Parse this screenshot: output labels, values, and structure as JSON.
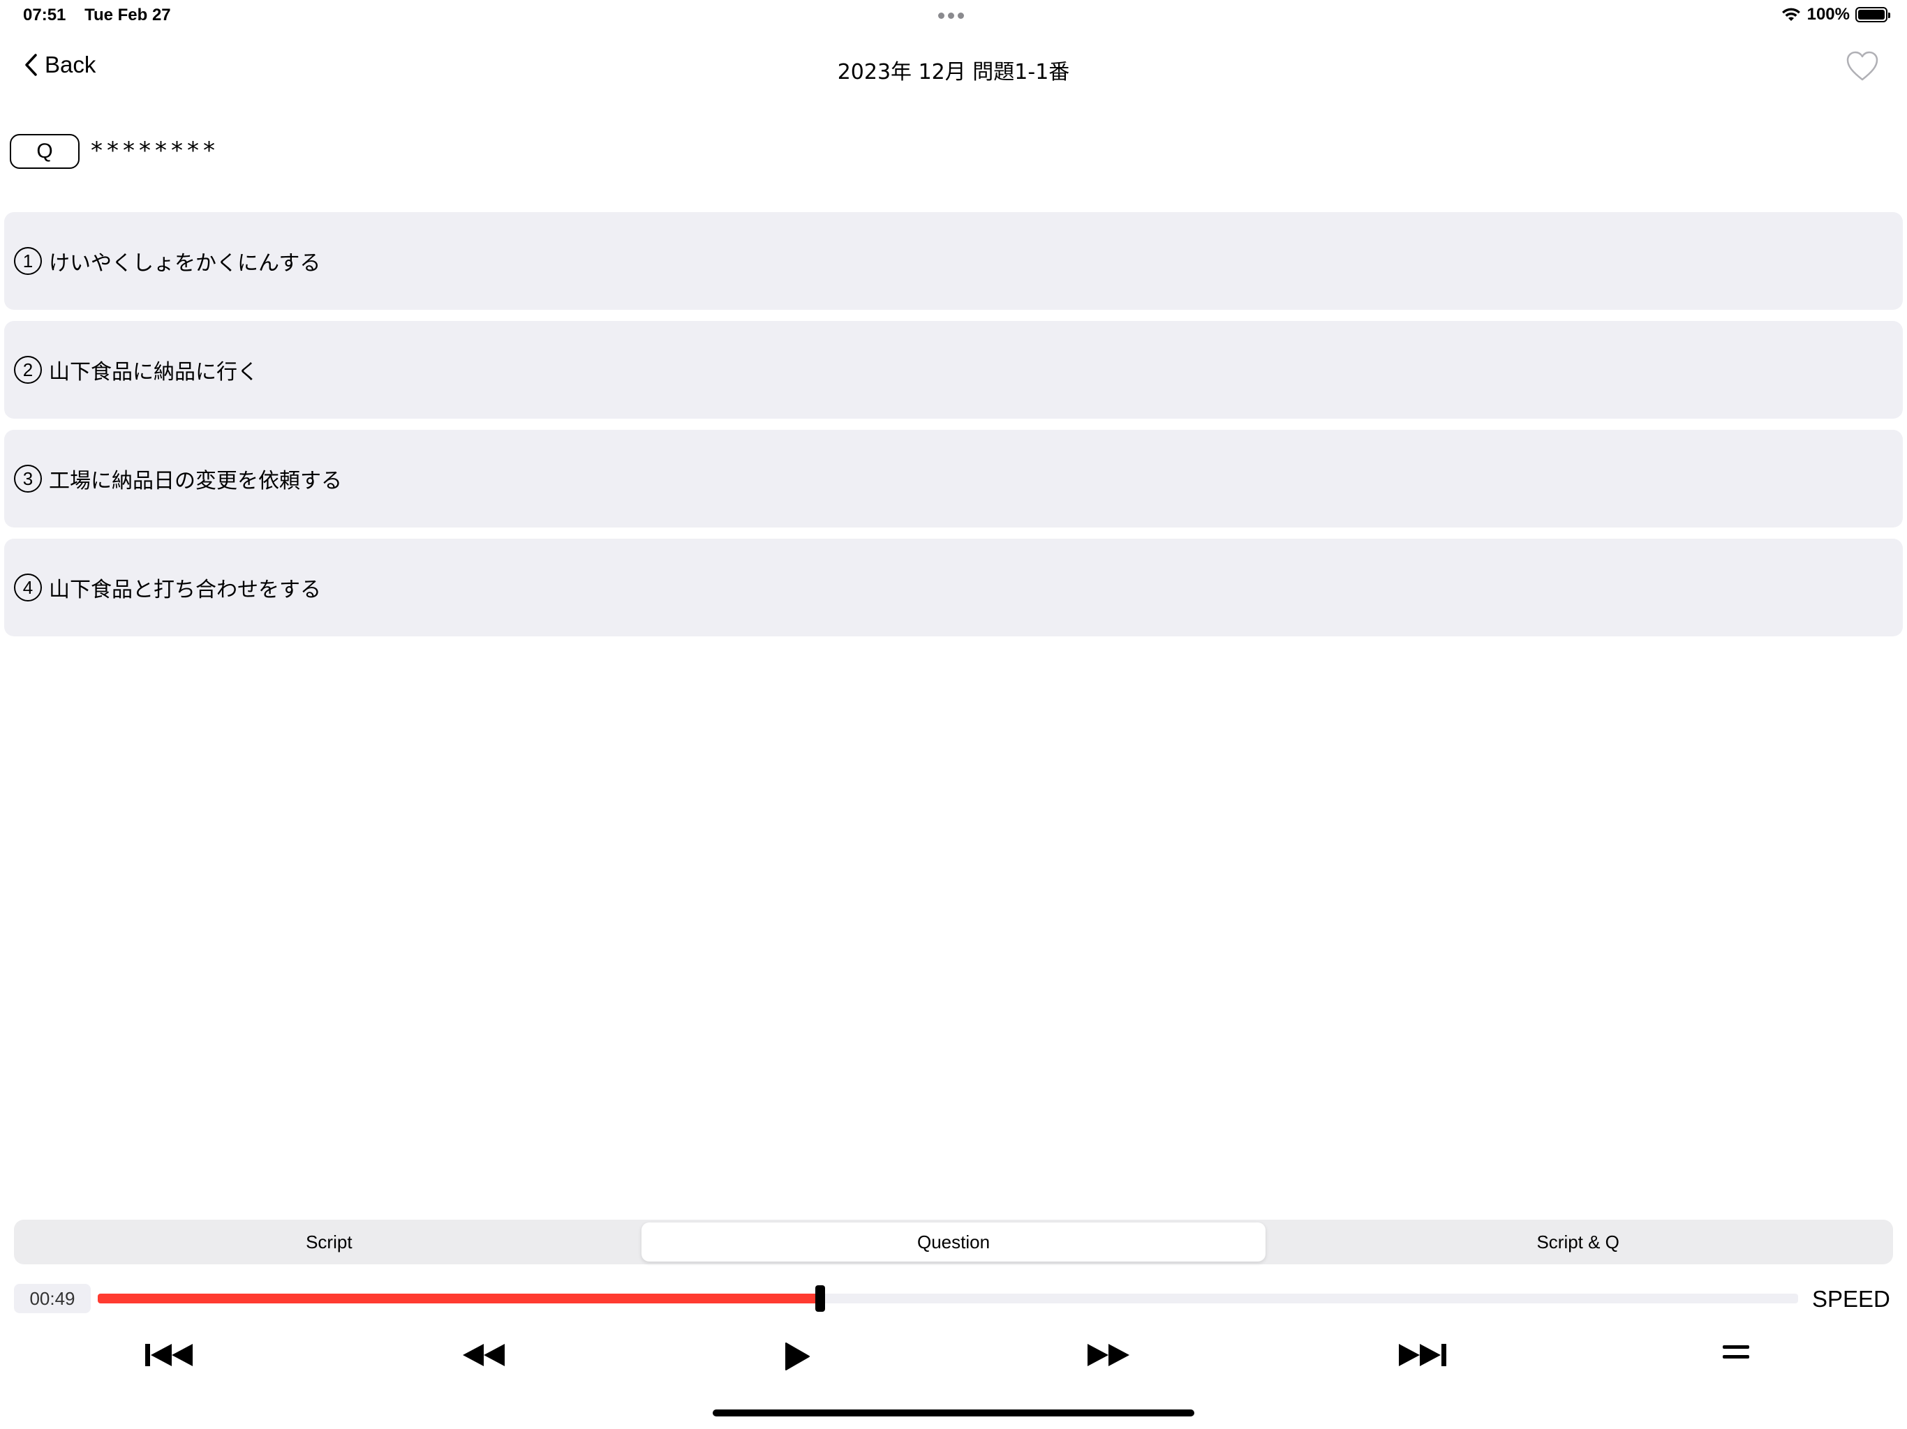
{
  "status_bar": {
    "time": "07:51",
    "date": "Tue Feb 27",
    "battery_percent": "100%"
  },
  "nav": {
    "back_label": "Back",
    "title": "2023年 12月 問題1-1番"
  },
  "question": {
    "badge": "Q",
    "text": "********"
  },
  "options": [
    {
      "number": "1",
      "text": "けいやくしょをかくにんする"
    },
    {
      "number": "2",
      "text": "山下食品に納品に行く"
    },
    {
      "number": "3",
      "text": "工場に納品日の変更を依頼する"
    },
    {
      "number": "4",
      "text": "山下食品と打ち合わせをする"
    }
  ],
  "tabs": {
    "script": "Script",
    "question": "Question",
    "script_q": "Script & Q",
    "active": "question"
  },
  "player": {
    "elapsed": "00:49",
    "progress": 0.425,
    "speed_label": "SPEED",
    "played_color": "#ff3b30",
    "controls": [
      "skip-to-start-icon",
      "rewind-icon",
      "play-icon",
      "fast-forward-icon",
      "skip-to-end-icon",
      "menu-icon"
    ]
  }
}
